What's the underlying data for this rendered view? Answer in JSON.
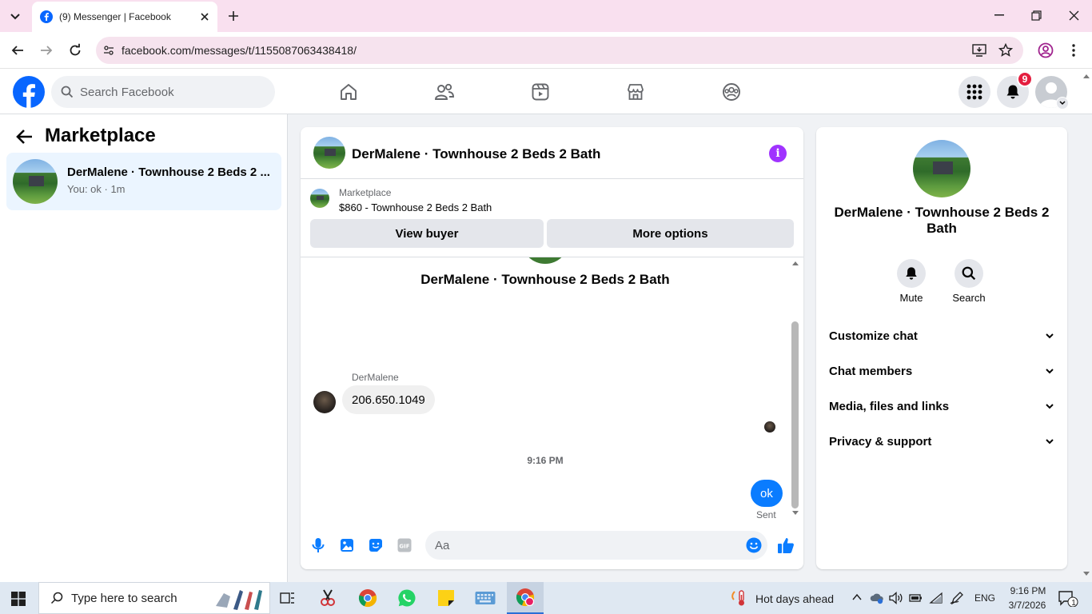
{
  "browser": {
    "tab_title": "(9) Messenger | Facebook",
    "url": "facebook.com/messages/t/1155087063438418/"
  },
  "facebook": {
    "search_placeholder": "Search Facebook",
    "notification_count": "9"
  },
  "left_panel": {
    "title": "Marketplace",
    "conversation": {
      "name": "DerMalene · Townhouse 2 Beds 2 ...",
      "preview": "You: ok · 1m"
    }
  },
  "chat": {
    "header_name": "DerMalene · Townhouse 2 Beds 2 Bath",
    "marketplace_label": "Marketplace",
    "listing": "$860 - Townhouse 2 Beds 2 Bath",
    "view_buyer": "View buyer",
    "more_options": "More options",
    "thread_title": "DerMalene · Townhouse 2 Beds 2 Bath",
    "messages": [
      {
        "sender": "DerMalene",
        "text": "206.650.1049",
        "direction": "incoming"
      },
      {
        "timestamp": "9:16 PM"
      },
      {
        "text": "ok",
        "direction": "outgoing",
        "status": "Sent"
      }
    ],
    "composer_placeholder": "Aa"
  },
  "right_panel": {
    "name": "DerMalene · Townhouse 2 Beds 2 Bath",
    "mute_label": "Mute",
    "search_label": "Search",
    "sections": [
      "Customize chat",
      "Chat members",
      "Media, files and links",
      "Privacy & support"
    ]
  },
  "taskbar": {
    "search_placeholder": "Type here to search",
    "weather": "Hot days ahead",
    "language": "ENG",
    "time": "9:16 PM",
    "date": "3/7/2026",
    "notification_count": "1"
  },
  "colors": {
    "messenger_blue": "#0a7cff",
    "facebook_blue": "#0866ff",
    "info_purple": "#a033ff",
    "badge_red": "#e41e3f"
  }
}
